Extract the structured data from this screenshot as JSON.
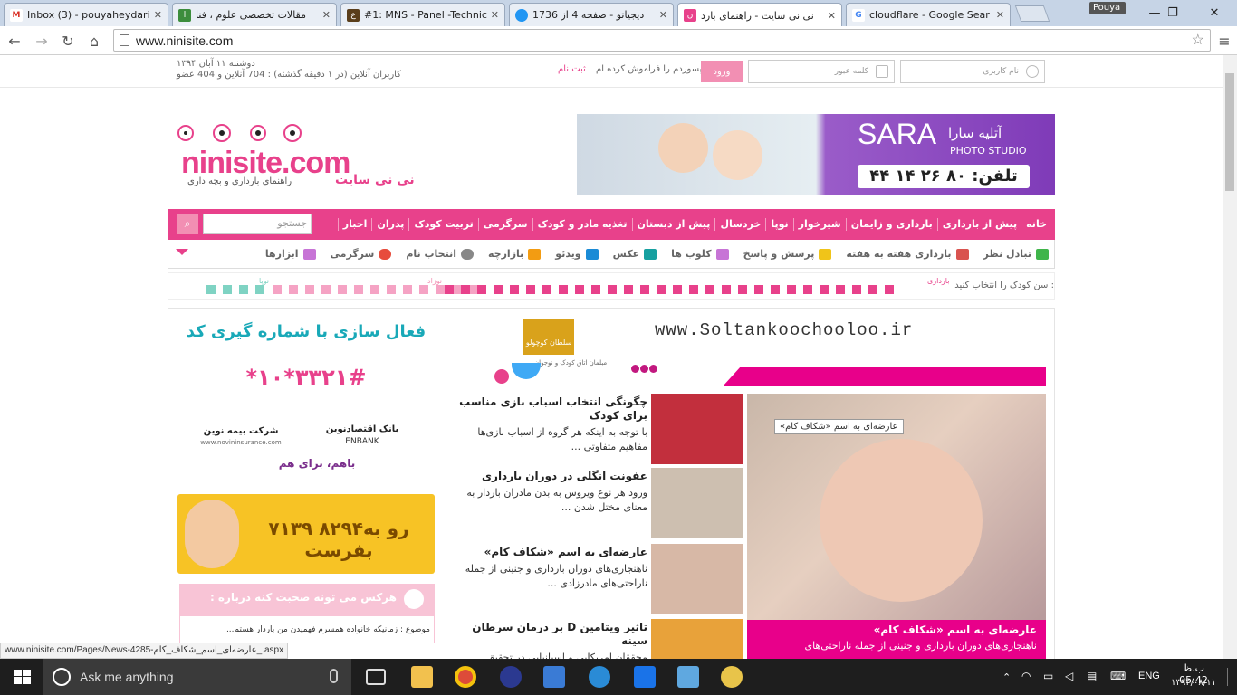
{
  "tabs": [
    {
      "label": "Inbox (3) - pouyaheydari",
      "color": "#d93025",
      "glyph": "M"
    },
    {
      "label": "مقالات تخصصی علوم ، فنا",
      "color": "#3c8d3c",
      "glyph": "ا"
    },
    {
      "label": "#1: MNS - Panel -Technic",
      "color": "#5a3e1b",
      "glyph": "ع"
    },
    {
      "label": "دیجیاتو - صفحه 4 از 1736",
      "color": "#2196f3",
      "glyph": ""
    },
    {
      "label": "نی نی سایت - راهنمای بارد",
      "color": "#e8418b",
      "glyph": "ن"
    },
    {
      "label": "cloudflare - Google Sear",
      "color": "#4285f4",
      "glyph": "G"
    }
  ],
  "profile_name": "Pouya",
  "url": "www.ninisite.com",
  "header": {
    "date": "دوشنبه ۱۱ آبان ۱۳۹۴",
    "online": "کاربران آنلاین (در ۱ دقیقه گذشته) : 704 آنلاین و 404 عضو",
    "register": "ثبت نام",
    "forgot": "پسوردم را فراموش کرده ام",
    "login_btn": "ورود",
    "password_ph": "کلمه عبور",
    "username_ph": "نام کاربری"
  },
  "logo": {
    "name": "ninisite.com",
    "fa": "نی نی سایت",
    "tagline": "راهنمای بارداری و بچه داری"
  },
  "banner": {
    "title": "آتلیه سارا",
    "brand": "SARA",
    "sub": "PHOTO STUDIO",
    "phone": "تلفن: ۸۰ ۲۶ ۱۴ ۴۴"
  },
  "search_ph": "جستجو",
  "main_nav": [
    "خانه",
    "پیش از بارداری",
    "بارداری و زایمان",
    "شیرخوار",
    "نوپا",
    "خردسال",
    "پیش از دبستان",
    "تغذیه مادر و کودک",
    "سرگرمی",
    "تربیت کودک",
    "پدران",
    "اخبار"
  ],
  "sub_nav": [
    "تبادل نظر",
    "بارداری هفته به هفته",
    "پرسش و پاسخ",
    "کلوب ها",
    "عکس",
    "ویدئو",
    "بازارچه",
    "انتخاب نام",
    "سرگرمی",
    "ابزارها"
  ],
  "sub_nav_colors": [
    "#3fb54a",
    "#d9534f",
    "#f0c419",
    "#c774d6",
    "#16a0a0",
    "#1a8bd6",
    "#f39c12",
    "#666666",
    "#e74c3c",
    "#c774d6"
  ],
  "age": {
    "label": "سن کودک را انتخاب کنید :",
    "pregnancy": "بارداری",
    "newborn": "نوزاد",
    "baby": "نوپا"
  },
  "ad1": {
    "line1": "فعال سازی با شماره گیری کد",
    "code": "*۱۰*۳۳۲۱#",
    "bank": "بانک اقتصادنوین",
    "bank_en": "ENBANK",
    "insurance": "شرکت بیمه نوین",
    "insurance_url": "www.novininsurance.com",
    "slogan": "باهم، برای هم"
  },
  "ad2": {
    "text": "۷۱۳۹ رو به۸۲۹۴ بفرست"
  },
  "chat": {
    "title": "هرکس می تونه صحبت کنه درباره :",
    "topic": "موضوع : زمانیکه خانواده همسرم فهمیدن من باردار هستم..."
  },
  "soltan": {
    "url": "www.Soltankoochooloo.ir",
    "brand": "سلطان کوچولو",
    "sub": "مبلمان اتاق کودک و نوجوان"
  },
  "news": [
    {
      "title": "چگونگی انتخاب اسباب بازی مناسب برای کودک",
      "body": "با توجه به اینکه هر گروه از اسباب بازی‌ها مفاهیم متفاوتی ..."
    },
    {
      "title": "عفونت انگلی در دوران بارداری",
      "body": "ورود هر نوع ویروس به بدن مادران باردار به معنای مختل شدن ..."
    },
    {
      "title": "عارضه‌ای به اسم «شکاف کام»",
      "body": "ناهنجاری‌های دوران بارداری و جنینی از جمله ناراحتی‌های مادرزادی ..."
    },
    {
      "title": "تاثیر ویتامین D بر درمان سرطان سینه",
      "body": "محققان امریکایی و اسپانیایی در تحقیق مشترکی دریافتند ..."
    }
  ],
  "featured": {
    "badge": "عارضه‌ای به اسم «شکاف کام»",
    "title": "عارضه‌ای به اسم «شکاف کام»",
    "body": "ناهنجاری‌های دوران بارداری و جنینی از جمله ناراحتی‌های"
  },
  "status_url": "www.ninisite.com/Pages/News-4285-عارضه‌ای_اسم_شکاف_کام_.aspx",
  "taskbar": {
    "search": "Ask me anything",
    "lang": "ENG",
    "time": "ب.ظ 05:42",
    "date": "۱۳۹۴/۰۸/۱۱"
  }
}
